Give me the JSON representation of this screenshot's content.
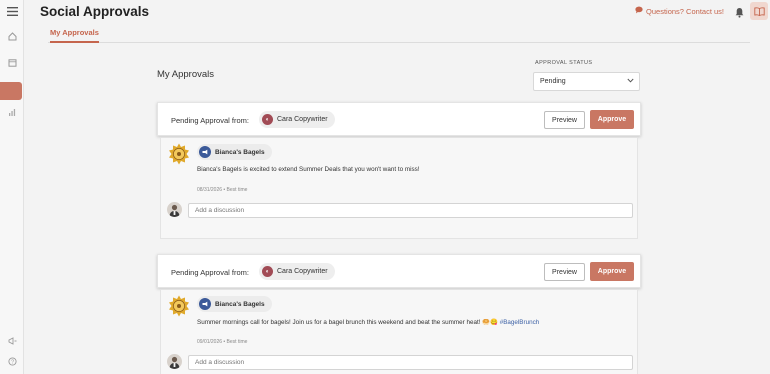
{
  "app": {
    "title": "Social Approvals"
  },
  "topbar": {
    "contact_label": "Questions? Contact us!"
  },
  "tabs": [
    {
      "label": "My Approvals"
    }
  ],
  "page": {
    "heading": "My Approvals"
  },
  "filter": {
    "status_label": "APPROVAL STATUS",
    "status_value": "Pending"
  },
  "approvals": [
    {
      "pending_label": "Pending Approval from:",
      "approver": "Cara Copywriter",
      "preview_label": "Preview",
      "approve_label": "Approve",
      "page_name": "Bianca's Bagels",
      "post_text": "Bianca's Bagels is excited to extend Summer Deals that you won't want to miss!",
      "post_hashtag": "",
      "post_meta": "08/31/2026 • Best time",
      "discussion_placeholder": "Add a discussion"
    },
    {
      "pending_label": "Pending Approval from:",
      "approver": "Cara Copywriter",
      "preview_label": "Preview",
      "approve_label": "Approve",
      "page_name": "Bianca's Bagels",
      "post_text": "Summer mornings call for bagels! Join us for a bagel brunch this weekend and beat the summer heat! 🥯😋 ",
      "post_hashtag": "#BagelBrunch",
      "post_meta": "09/01/2026 • Best time",
      "discussion_placeholder": "Add a discussion"
    }
  ],
  "colors": {
    "accent": "#c97763",
    "accent_text": "#c5654d",
    "facebook": "#3c5a99",
    "approver_avatar": "#a14b55"
  },
  "icons": {
    "sidebar": [
      "hamburger-icon",
      "home-icon",
      "calendar-icon",
      "approvals-icon",
      "analytics-icon",
      "megaphone-icon",
      "help-icon"
    ],
    "topbar": [
      "chat-bubble-icon",
      "bell-icon",
      "book-icon"
    ],
    "post": [
      "bagel-logo-icon",
      "facebook-icon",
      "user-avatar-icon"
    ]
  }
}
